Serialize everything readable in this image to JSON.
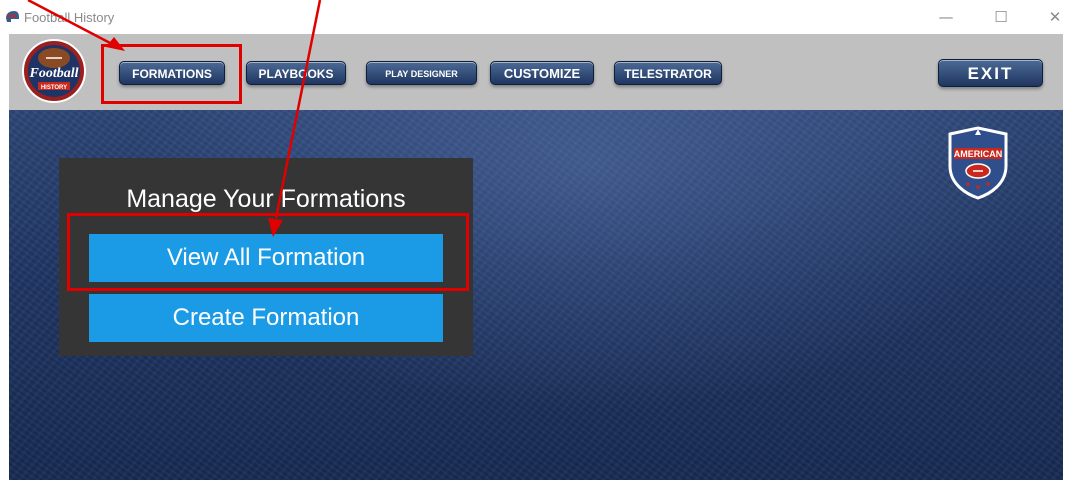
{
  "window": {
    "title": "Football History",
    "app_icon": "football-helmet-icon",
    "controls": {
      "minimize": "minimize-icon",
      "maximize": "maximize-icon",
      "close": "close-icon"
    }
  },
  "toolbar": {
    "logo": {
      "text_main": "Football",
      "text_sub": "HISTORY"
    },
    "nav": [
      {
        "label": "FORMATIONS"
      },
      {
        "label": "PLAYBOOKS"
      },
      {
        "label": "PLAY DESIGNER"
      },
      {
        "label": "CUSTOMIZE"
      },
      {
        "label": "TELESTRATOR"
      }
    ],
    "exit_label": "EXIT"
  },
  "badge": {
    "text": "AMERICAN"
  },
  "panel": {
    "title": "Manage Your Formations",
    "buttons": [
      {
        "label": "View All Formation"
      },
      {
        "label": "Create Formation"
      }
    ]
  },
  "colors": {
    "nav_button": "#2a4370",
    "panel_bg": "#353535",
    "panel_button": "#1b9be6",
    "annotation": "#e00000",
    "toolbar_bg": "#c0c0c0",
    "main_bg": "#1f3563"
  }
}
